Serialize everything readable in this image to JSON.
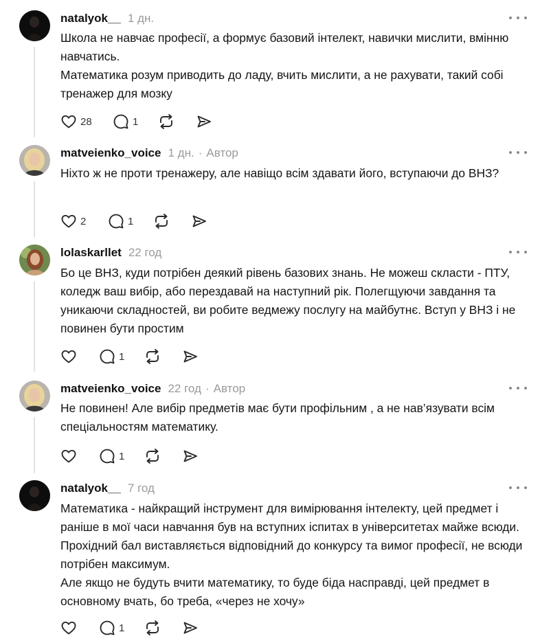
{
  "posts": [
    {
      "username": "natalyok__",
      "time": "1 дн.",
      "author_label": "",
      "paragraphs": [
        "Школа не навчає професії, а формує базовий інтелект, навички мислити, вмінню навчатись.",
        "Математика розум приводить до ладу, вчить мислити, а не рахувати, такий собі тренажер для мозку"
      ],
      "likes": "28",
      "replies": "1"
    },
    {
      "username": "matveienko_voice",
      "time": "1 дн.",
      "author_label": "Автор",
      "paragraphs": [
        "Ніхто ж не проти тренажеру, але навіщо всім здавати його, вступаючи до ВНЗ?"
      ],
      "likes": "2",
      "replies": "1"
    },
    {
      "username": "lolaskarllet",
      "time": "22 год",
      "author_label": "",
      "paragraphs": [
        "Бо це ВНЗ, куди потрібен деякий рівень базових знань. Не можеш скласти - ПТУ, коледж ваш вибір, або перездавай на наступний рік. Полегщуючи завдання та уникаючи складностей, ви робите ведмежу послугу на майбутнє. Вступ у ВНЗ і не повинен бути простим"
      ],
      "likes": "",
      "replies": "1"
    },
    {
      "username": "matveienko_voice",
      "time": "22 год",
      "author_label": "Автор",
      "paragraphs": [
        "Не повинен! Але вибір предметів має бути профільним , а не нав’язувати всім спеціальностям математику."
      ],
      "likes": "",
      "replies": "1"
    },
    {
      "username": "natalyok__",
      "time": "7 год",
      "author_label": "",
      "paragraphs": [
        "Математика - найкращий інструмент для вимірювання інтелекту, цей предмет і раніше в мої часи навчання був на вступних іспитах в університетах майже всюди. Прохідний бал виставляється відповідний до конкурсу та вимог професії, не всюди потрібен максимум.",
        "Але якщо не будуть вчити математику, то буде біда насправді, цей предмет в основному вчать, бо треба, «через не хочу»"
      ],
      "likes": "",
      "replies": "1"
    }
  ],
  "colors": {
    "text": "#151515",
    "muted": "#9a9a9a",
    "thread_line": "#e2e2e2",
    "icon": "#2a2a2a"
  },
  "icons": [
    "heart-icon",
    "comment-icon",
    "repost-icon",
    "share-icon",
    "more-icon"
  ]
}
